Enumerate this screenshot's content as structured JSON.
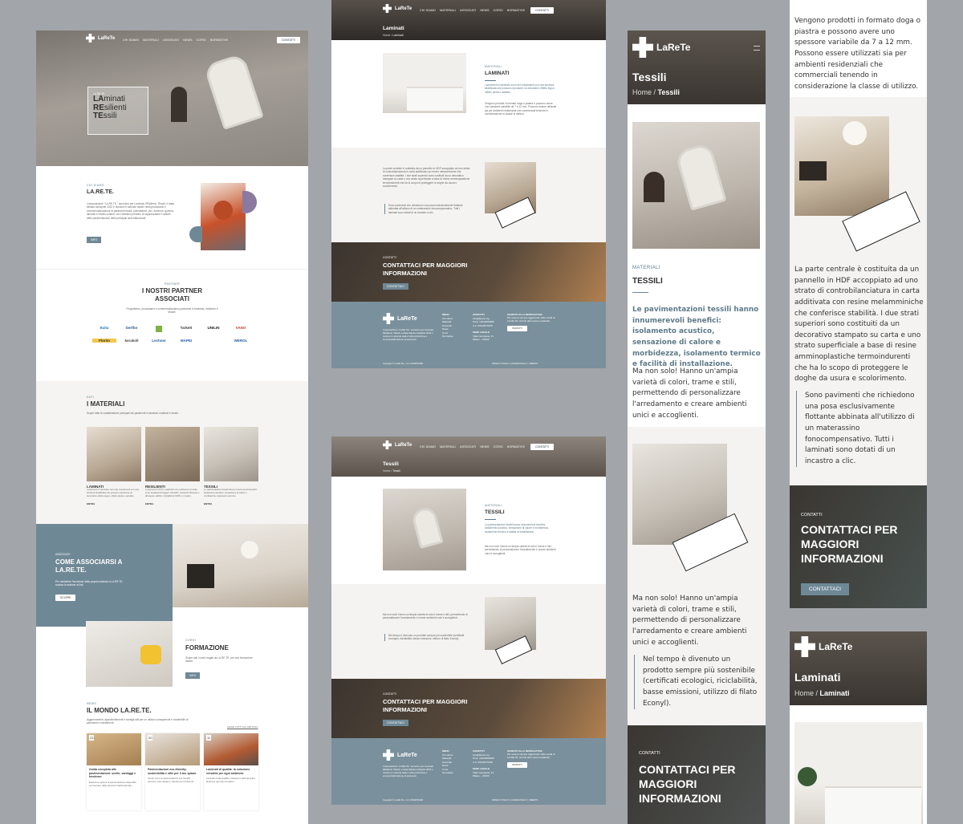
{
  "brand": {
    "name": "LaReTe",
    "tagline": "Laminati Resilienti Tessili"
  },
  "nav": {
    "items": [
      "CHI SIAMO",
      "MATERIALI",
      "ASSOCIATI",
      "NEWS",
      "CORSI",
      "NORMATIVE"
    ],
    "contact_button": "CONTATTI"
  },
  "colors": {
    "slate": "#6f8896",
    "footer": "#7a909c",
    "text": "#333333",
    "page_bg": "#a2a6aa"
  },
  "home": {
    "hero": {
      "kicker": "LA.RE.TE.",
      "line1_bold": "LA",
      "line1_rest": "minati",
      "line2_bold": "RE",
      "line2_rest": "silienti",
      "line3_bold": "TE",
      "line3_rest": "ssili"
    },
    "about": {
      "kicker": "CHI SIAMO",
      "title": "LA.RE.TE.",
      "body": "L'associazione \"LA.RE.TE.\" acronimo per Laminati, REsilienti, TEssili, è stata istituita nell'aprile 2022 e riunisce le aziende leader nella produzione e commercializzazione di pavimenti tessili, poliuretanici, pvc, linoleum, gomma, laminati e relativi collanti, con l'obiettivo primario di rappresentare il settore delle pavimentazioni nelle principali sedi istituzionali.",
      "button": "INFO"
    },
    "partners": {
      "kicker": "PARTNER",
      "title": "I NOSTRI PARTNER ASSOCIATI",
      "body": "Progettiamo, produciamo e commercializziamo pavimenti in laminato, resiliente e tessile.",
      "logos": [
        "Balta",
        "Gerflor",
        "",
        "Tarkett",
        "UNILIN",
        "VANO",
        "Florim",
        "kerakoll",
        "Lechner",
        "MAPEI",
        "",
        "WEROL"
      ]
    },
    "materials": {
      "kicker": "DATI",
      "title": "I MATERIALI",
      "body": "Scopri tutte le caratteristiche principali dei pavimenti in laminati, resilienti e tessili.",
      "cards": [
        {
          "title": "LAMINATI",
          "body": "I pavimenti in laminato sono dei rivestimenti con una struttura stratificata che possono riprodurre un decorativo effetto legno, effetto pietra o astratto.",
          "link": "ENTRA"
        },
        {
          "title": "RESILIENTI",
          "body": "I pavimenti in PVC, realizzati con policloruro di vinile, sono fondamenti leggeri, flessibili, resistenti all'usura e all'acqua, stabili e riciclabili al 100% o in parte.",
          "link": "ENTRA"
        },
        {
          "title": "TESSILI",
          "body": "Le pavimentazioni tessili hanno innumerevoli benefici: isolamento acustico, sensazione di calore e morbidezza, isolamento termico.",
          "link": "ENTRA"
        }
      ]
    },
    "associate": {
      "kicker": "ASSOCIATI",
      "title": "COME ASSOCIARSI A LA.RE.TE.",
      "body": "Per richiedere l'iscrizione della propria azienda a LA.RE.TE. scarica la sezione al link.",
      "button": "SCOPRI"
    },
    "training": {
      "kicker": "CORSI",
      "title": "FORMAZIONE",
      "body": "Scopri tutti i corsi erogati da LA.RE.TE. per una formazione mirata.",
      "button": "INFO"
    },
    "news": {
      "kicker": "NEWS",
      "title": "IL MONDO LA.RE.TE.",
      "body": "Aggiornamenti, approfondimenti e consigli utili per un utilizzo consapevole e sostenibile di pavimenti e rivestimenti.",
      "all_link": "LEGGI TUTTI GLI ARTICOLI",
      "cards": [
        {
          "day": "23",
          "title": "Guida completa alle pavimentazioni: scelte, vantaggi e tendenze",
          "body": "Esplora le opzioni di pavimentazione disponibili sul mercato, dalle soluzioni tradizionali alle..."
        },
        {
          "day": "20",
          "title": "Pavimentazioni eco-friendly: sostenibilità e stile per il tuo spazio",
          "body": "Scopri come le pavimentazioni eco-friendly possono unire design e rispetto per l'ambiente..."
        },
        {
          "day": "11",
          "title": "Laminati di qualità: la soluzione versatile per ogni ambiente",
          "body": "Laminati di alta qualità, resistenti e facili da pulire, ideali per ogni tipo di spazio..."
        }
      ]
    }
  },
  "laminati": {
    "page_title": "Laminati",
    "breadcrumb_home": "Home",
    "breadcrumb_current": "Laminati",
    "kicker": "MATERIALI",
    "title": "LAMINATI",
    "lead": "I pavimenti in laminato sono dei rivestimenti con una struttura stratificata che possono riprodurre un decorativo effetto legno, effetto pietra o astratto.",
    "body1": "Vengono prodotti in formato doga o piastra e possono avere uno spessore variabile da 7 a 12 mm. Possono essere utilizzati sia per ambienti residenziali che commerciali tenendo in considerazione la classe di utilizzo.",
    "body2": "La parte centrale è costituita da un pannello in HDF accoppiato ad uno strato di controbilanciatura in carta additivata con resine melamminiche che conferisce stabilità. I due strati superiori sono costituiti da un decorativo stampato su carta e uno strato superficiale a base di resine amminoplastiche termoindurenti che ha lo scopo di proteggere le doghe da usura e scolorimento.",
    "quote": "Sono pavimenti che richiedono una posa esclusivamente flottante abbinata all'utilizzo di un materassino fonocompensativo. Tutti i laminati sono dotati di un incastro a clic."
  },
  "tessili": {
    "page_title": "Tessili",
    "breadcrumb_home": "Home",
    "breadcrumb_current": "Tessili",
    "kicker": "MATERIALI",
    "title": "TESSILI",
    "lead": "Le pavimentazioni tessili hanno innumerevoli benefici: isolamento acustico, sensazione di calore e morbidezza, isolamento termico e facilità di installazione.",
    "body": "Ma non solo! Hanno un'ampia varietà di colori, trame e stili, permettendo di personalizzare l'arredamento e creare ambienti unici e accoglienti.",
    "quote": "Nel tempo è divenuto un prodotto sempre più sostenibile (certificati ecologici, riciclabilità, basse emissioni, utilizzo di filato Econyl)."
  },
  "contact": {
    "kicker": "CONTATTI",
    "title": "CONTATTACI PER MAGGIORI INFORMAZIONI",
    "button": "CONTATTACI"
  },
  "footer": {
    "about": "L'associazione \"LA.RE.TE.\" acronimo per Laminati, REsilienti, TEssili, è stata istituita nell'aprile 2022 e riunisce le aziende leader nella produzione e commercializzazione di pavimenti.",
    "menu_title": "MENU",
    "menu_items": [
      "Chi siamo",
      "Materiali",
      "Associati",
      "News",
      "Corsi",
      "Normative"
    ],
    "contact_title": "CONTATTI",
    "contact_lines": [
      "info@larete.org",
      "P.Iva: 13642060968",
      "C.F. 97942570158"
    ],
    "newsletter_title": "ISCRIVITI ALLA NEWSLETTER",
    "newsletter_body": "Per essere sempre aggiornato sulle novità di LA.RE.TE. iscriviti alla nostra newsletter.",
    "newsletter_button": "ISCRIVITI",
    "office_title": "SEDE LEGALE",
    "office_lines": [
      "Viale Campania, 31",
      "Milano – 20133"
    ],
    "copyright": "Copyright © LA.RE.TE. | C.F. 97942570158",
    "legal": "PRIVACY POLICY | COOKIE POLICY | CREDITS"
  }
}
